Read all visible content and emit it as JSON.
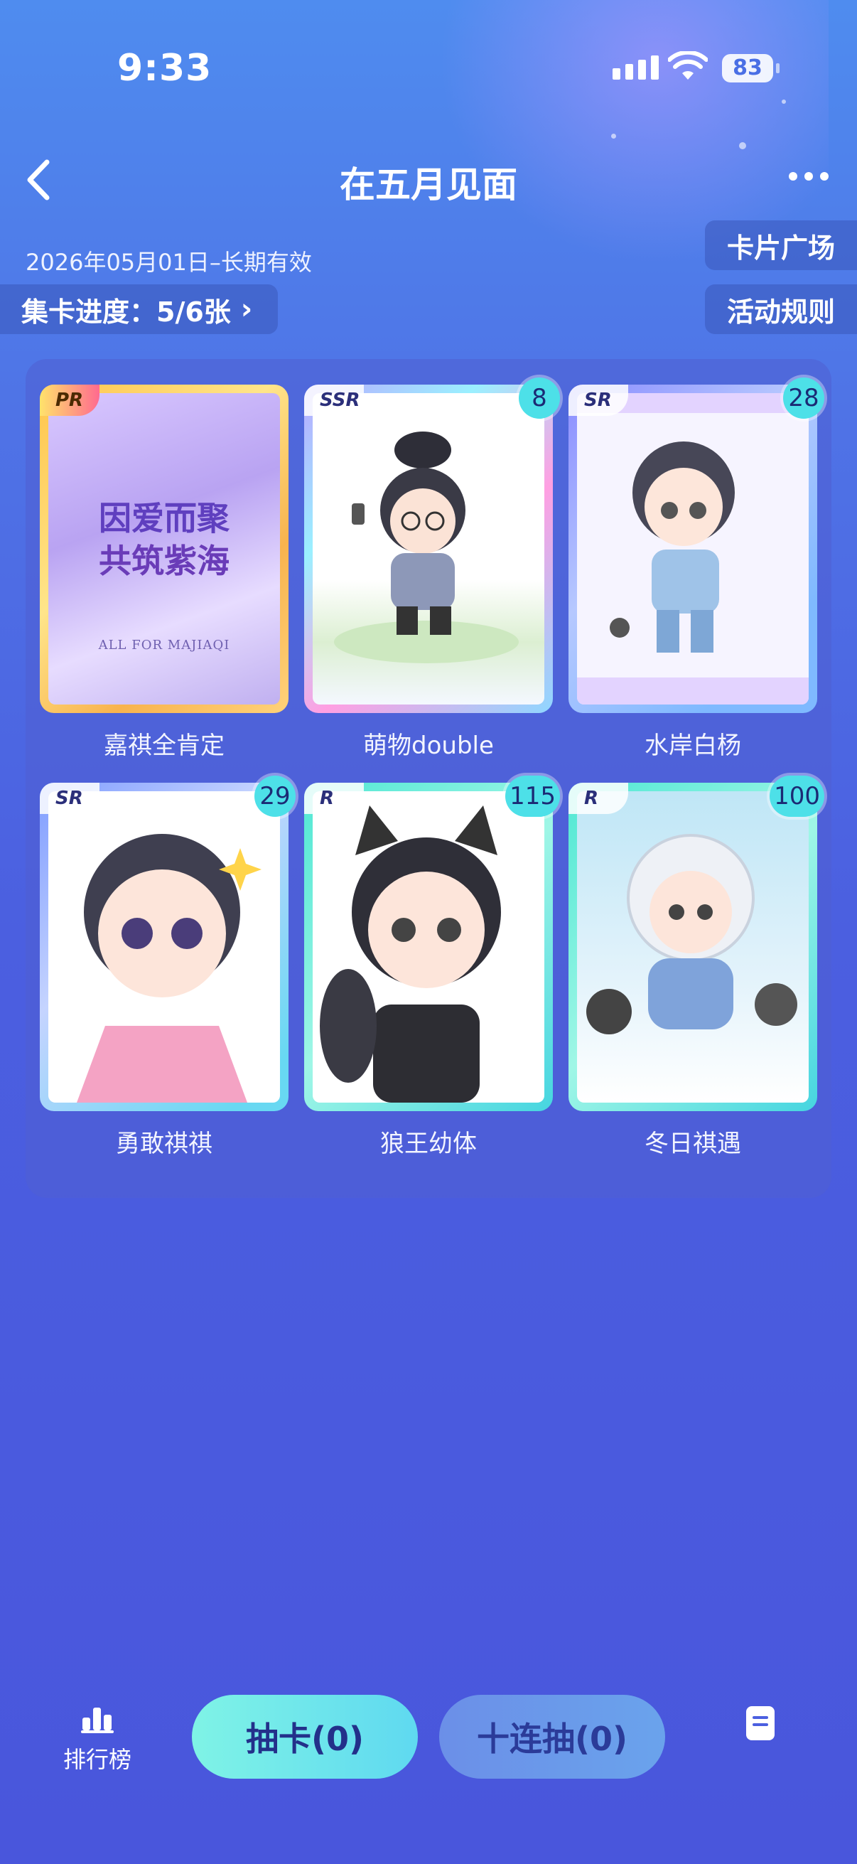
{
  "status": {
    "time": "9:33",
    "battery": "83"
  },
  "nav": {
    "title": "在五月见面"
  },
  "event": {
    "date": "2026年05月01日–长期有效",
    "progress": "集卡进度：5/6张",
    "plaza_label": "卡片广场",
    "rules_label": "活动规则"
  },
  "cards": [
    {
      "rarity": "PR",
      "count": "",
      "name": "嘉祺全肯定",
      "art_text_1": "因爱而聚",
      "art_text_2": "共筑紫海",
      "art_text_3": "ALL FOR MAJIAQI"
    },
    {
      "rarity": "SSR",
      "count": "8",
      "name": "萌物double"
    },
    {
      "rarity": "SR",
      "count": "28",
      "name": "水岸白杨"
    },
    {
      "rarity": "SR",
      "count": "29",
      "name": "勇敢祺祺"
    },
    {
      "rarity": "R",
      "count": "115",
      "name": "狼王幼体"
    },
    {
      "rarity": "R",
      "count": "100",
      "name": "冬日祺遇"
    }
  ],
  "bottom": {
    "rank_label": "排行榜",
    "draw_label": "抽卡(0)",
    "draw10_label": "十连抽(0)"
  },
  "colors": {
    "accent": "#5fd9f0",
    "background": "#4b5fe0",
    "badge": "#4de0e8"
  }
}
